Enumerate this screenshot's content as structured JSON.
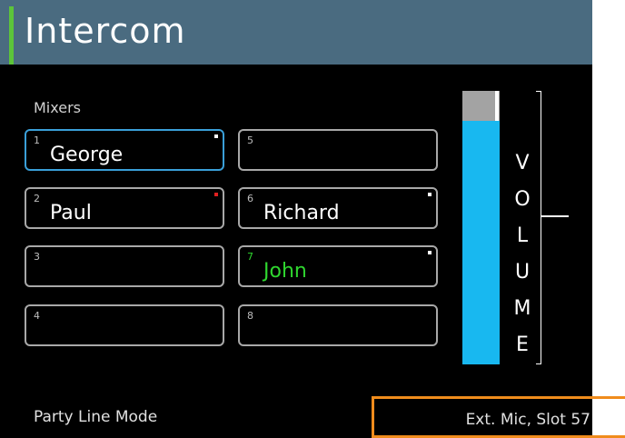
{
  "title": "Intercom",
  "mixers_label": "Mixers",
  "slots": [
    {
      "num": "1",
      "name": "George",
      "selected": true,
      "talking": false,
      "indicator": "white"
    },
    {
      "num": "2",
      "name": "Paul",
      "selected": false,
      "talking": false,
      "indicator": "red"
    },
    {
      "num": "3",
      "name": "",
      "selected": false,
      "talking": false,
      "indicator": ""
    },
    {
      "num": "4",
      "name": "",
      "selected": false,
      "talking": false,
      "indicator": ""
    },
    {
      "num": "5",
      "name": "",
      "selected": false,
      "talking": false,
      "indicator": ""
    },
    {
      "num": "6",
      "name": "Richard",
      "selected": false,
      "talking": false,
      "indicator": "white"
    },
    {
      "num": "7",
      "name": "John",
      "selected": false,
      "talking": true,
      "indicator": "white"
    },
    {
      "num": "8",
      "name": "",
      "selected": false,
      "talking": false,
      "indicator": ""
    }
  ],
  "volume": {
    "letters": [
      "V",
      "O",
      "L",
      "U",
      "M",
      "E"
    ],
    "level": 0.89
  },
  "footer": {
    "mode": "Party Line Mode",
    "source": "Ext. Mic, Slot 57"
  },
  "colors": {
    "title_bar": "#4a6b80",
    "title_accent": "#5cc43a",
    "selected_border": "#3a9fd8",
    "talking_text": "#2fd62f",
    "volume_fill": "#18b8f0",
    "highlight_box": "#f08c1c"
  }
}
